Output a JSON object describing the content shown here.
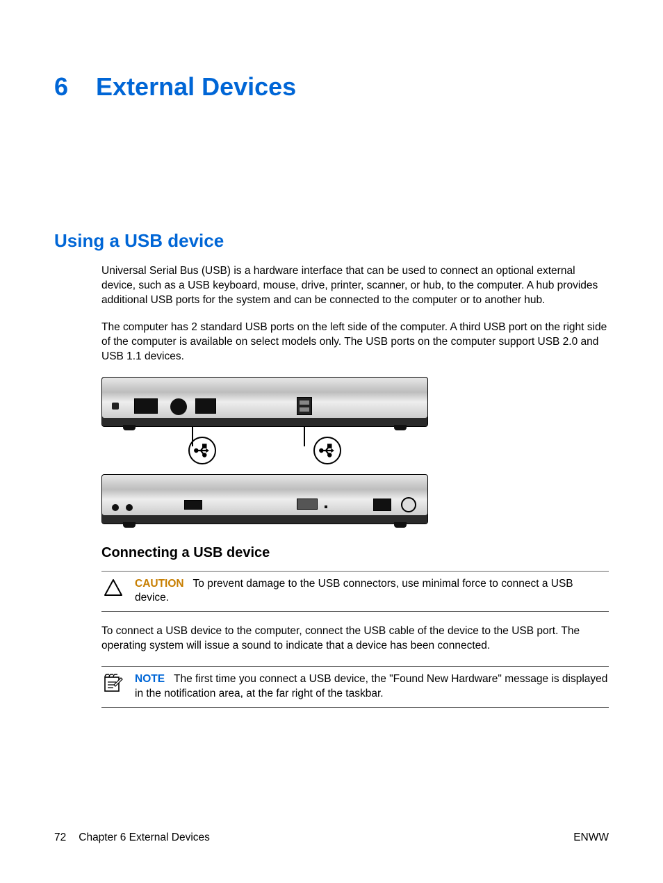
{
  "chapter": {
    "number": "6",
    "title": "External Devices"
  },
  "section": {
    "title": "Using a USB device"
  },
  "paragraphs": {
    "p1": "Universal Serial Bus (USB) is a hardware interface that can be used to connect an optional external device, such as a USB keyboard, mouse, drive, printer, scanner, or hub, to the computer. A hub provides additional USB ports for the system and can be connected to the computer or to another hub.",
    "p2": "The computer has 2 standard USB ports on the left side of the computer. A third USB port on the right side of the computer is available on select models only. The USB ports on the computer support USB 2.0 and USB 1.1 devices."
  },
  "subsection": {
    "title": "Connecting a USB device"
  },
  "caution": {
    "label": "CAUTION",
    "text": "To prevent damage to the USB connectors, use minimal force to connect a USB device."
  },
  "paragraphs2": {
    "p3": "To connect a USB device to the computer, connect the USB cable of the device to the USB port. The operating system will issue a sound to indicate that a device has been connected."
  },
  "note": {
    "label": "NOTE",
    "text": "The first time you connect a USB device, the \"Found New Hardware\" message is displayed in the notification area, at the far right of the taskbar."
  },
  "footer": {
    "page": "72",
    "chapter_ref": "Chapter 6   External Devices",
    "lang": "ENWW"
  }
}
